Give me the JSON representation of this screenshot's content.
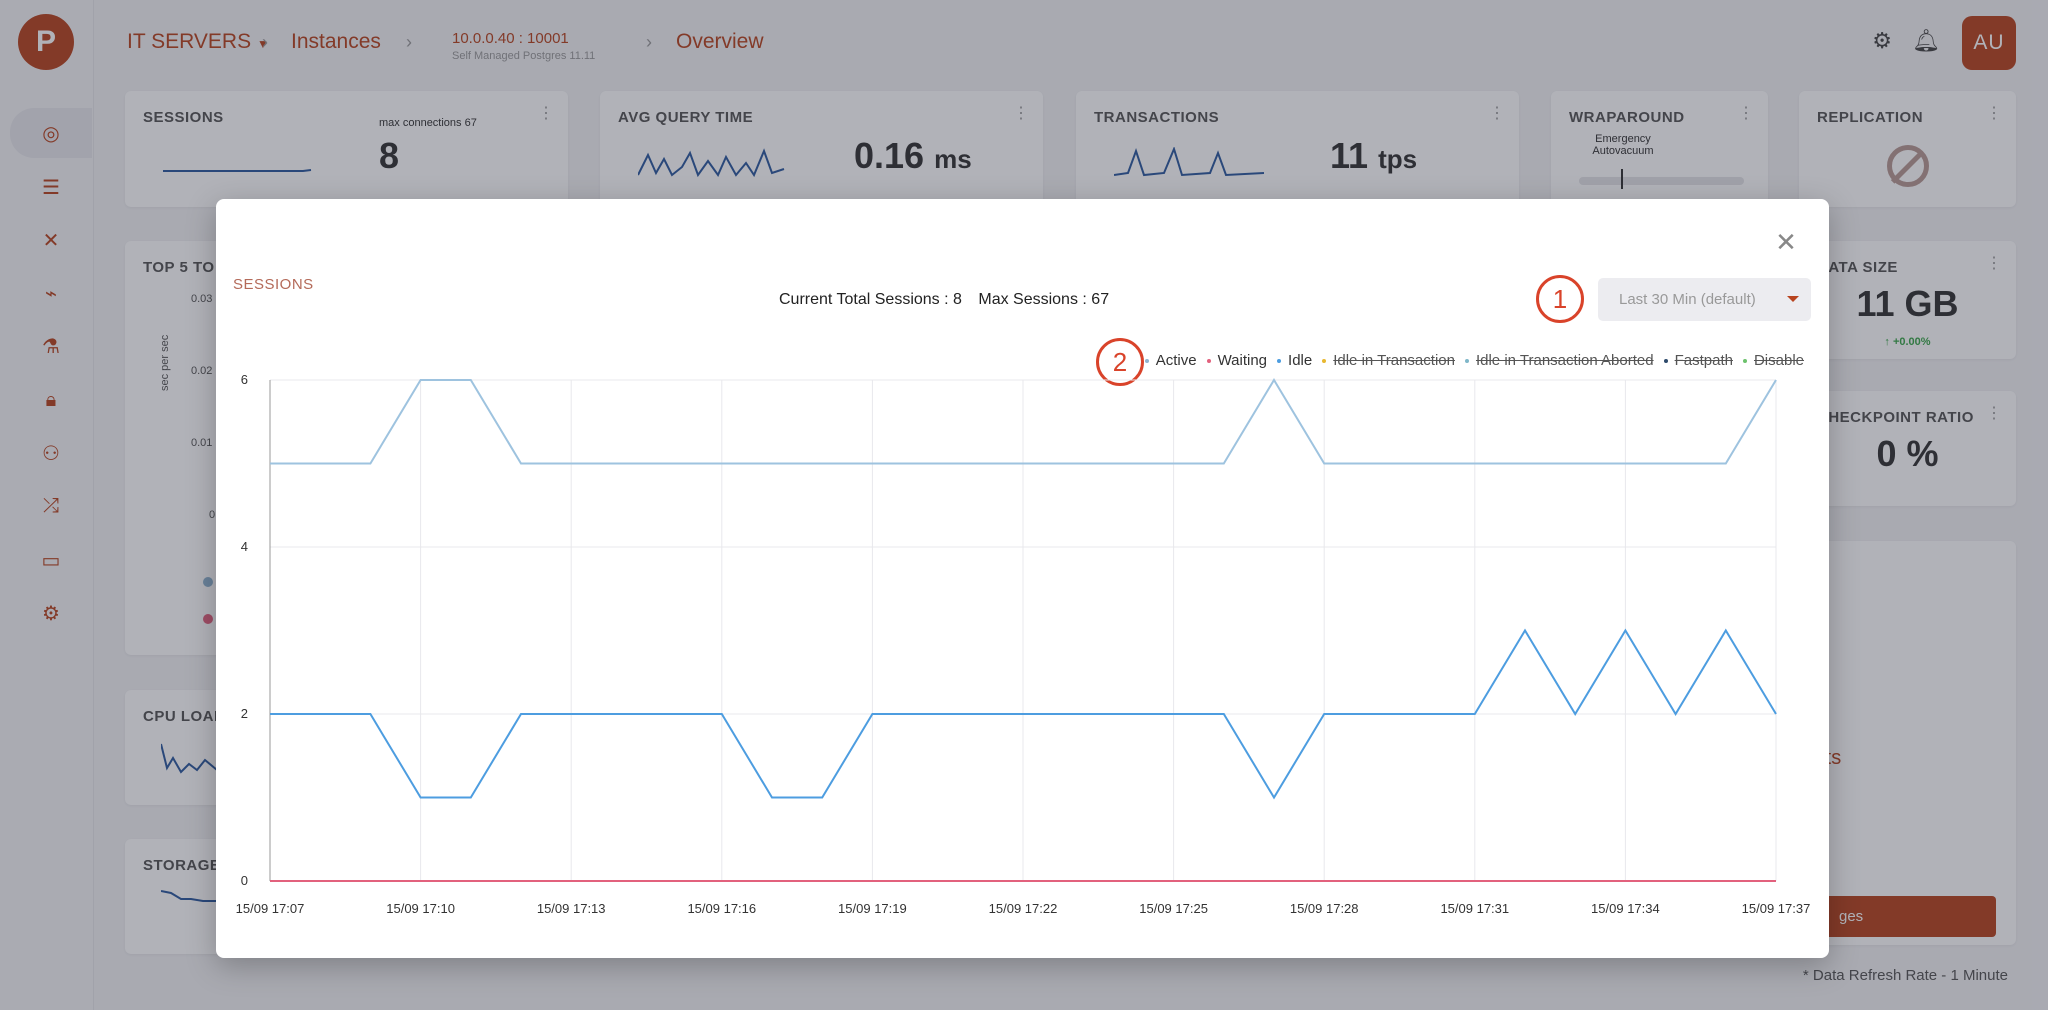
{
  "app": {
    "logo_glyph": "P",
    "nav_icons": [
      "dashboard-icon",
      "sliders-icon",
      "tools-icon",
      "telescope-icon",
      "microscope-icon",
      "lock-icon",
      "group-icon",
      "shuffle-icon",
      "folders-icon",
      "gear-icon"
    ]
  },
  "breadcrumb": {
    "group": "IT SERVERS",
    "section": "Instances",
    "instance": "10.0.0.40 : 10001",
    "instance_sub": "Self Managed Postgres 11.11",
    "page": "Overview"
  },
  "user": {
    "initials": "AU"
  },
  "cards": {
    "sessions": {
      "title": "SESSIONS",
      "caption": "max connections 67",
      "value": "8"
    },
    "query": {
      "title": "AVG QUERY TIME",
      "value": "0.16",
      "unit": "ms"
    },
    "transactions": {
      "title": "TRANSACTIONS",
      "value": "11",
      "unit": "tps"
    },
    "wraparound": {
      "title": "WRAPAROUND",
      "caption": "Emergency Autovacuum"
    },
    "replication": {
      "title": "REPLICATION"
    },
    "top5": {
      "title": "TOP 5 TO",
      "ylabel": "sec per sec",
      "ticks": [
        "0.03",
        "0.02",
        "0.01",
        "0"
      ]
    },
    "data_size": {
      "title": "DATA SIZE",
      "value": "11 GB",
      "delta": "↑ +0.00%"
    },
    "checkpoint": {
      "title": "CHECKPOINT RATIO",
      "value": "0 %"
    },
    "cpu": {
      "title": "CPU LOAD"
    },
    "storage": {
      "title": "STORAGE"
    },
    "reports_text": "rts",
    "action_button": "ges",
    "footnote": "* Data Refresh Rate - 1 Minute"
  },
  "modal": {
    "title": "SESSIONS",
    "current_total": "Current Total Sessions : 8",
    "max_sessions": "Max Sessions : 67",
    "range_label": "Last 30 Min (default)",
    "callouts": [
      "1",
      "2"
    ]
  },
  "chart_data": {
    "type": "line",
    "title": "SESSIONS",
    "x": [
      "15/09 17:07",
      "15/09 17:08",
      "15/09 17:09",
      "15/09 17:10",
      "15/09 17:11",
      "15/09 17:12",
      "15/09 17:13",
      "15/09 17:14",
      "15/09 17:15",
      "15/09 17:16",
      "15/09 17:17",
      "15/09 17:18",
      "15/09 17:19",
      "15/09 17:20",
      "15/09 17:21",
      "15/09 17:22",
      "15/09 17:23",
      "15/09 17:24",
      "15/09 17:25",
      "15/09 17:26",
      "15/09 17:27",
      "15/09 17:28",
      "15/09 17:29",
      "15/09 17:30",
      "15/09 17:31",
      "15/09 17:32",
      "15/09 17:33",
      "15/09 17:34",
      "15/09 17:35",
      "15/09 17:36",
      "15/09 17:37"
    ],
    "x_ticks": [
      "15/09 17:07",
      "15/09 17:10",
      "15/09 17:13",
      "15/09 17:16",
      "15/09 17:19",
      "15/09 17:22",
      "15/09 17:25",
      "15/09 17:28",
      "15/09 17:31",
      "15/09 17:34",
      "15/09 17:37"
    ],
    "ylim": [
      0,
      6
    ],
    "y_ticks": [
      0,
      2,
      4,
      6
    ],
    "grid": true,
    "legend_position": "top-right",
    "series": [
      {
        "name": "Active",
        "color": "#8fb3cf",
        "visible": true,
        "values": [
          0,
          0,
          0,
          0,
          0,
          0,
          0,
          0,
          0,
          0,
          0,
          0,
          0,
          0,
          0,
          0,
          0,
          0,
          0,
          0,
          0,
          0,
          0,
          0,
          0,
          0,
          0,
          0,
          0,
          0,
          0
        ]
      },
      {
        "name": "Waiting",
        "color": "#e2617d",
        "visible": true,
        "values": [
          0,
          0,
          0,
          0,
          0,
          0,
          0,
          0,
          0,
          0,
          0,
          0,
          0,
          0,
          0,
          0,
          0,
          0,
          0,
          0,
          0,
          0,
          0,
          0,
          0,
          0,
          0,
          0,
          0,
          0,
          0
        ]
      },
      {
        "name": "Idle",
        "color": "#4d9de0",
        "visible": true,
        "values": [
          2,
          2,
          2,
          1,
          1,
          2,
          2,
          2,
          2,
          2,
          1,
          1,
          2,
          2,
          2,
          2,
          2,
          2,
          2,
          2,
          1,
          2,
          2,
          2,
          2,
          3,
          2,
          3,
          2,
          3,
          2
        ]
      },
      {
        "name": "Idle in Transaction",
        "color": "#e8b830",
        "visible": false,
        "values": []
      },
      {
        "name": "Idle in Transaction Aborted",
        "color": "#7fb7c9",
        "visible": false,
        "values": []
      },
      {
        "name": "Fastpath",
        "color": "#2d4a6b",
        "visible": false,
        "values": []
      },
      {
        "name": "Disable",
        "color": "#6cc26c",
        "visible": false,
        "values": []
      },
      {
        "name": "",
        "color": "#9ec3df",
        "visible": true,
        "values": [
          5,
          5,
          5,
          6,
          6,
          5,
          5,
          5,
          5,
          5,
          5,
          5,
          5,
          5,
          5,
          5,
          5,
          5,
          5,
          5,
          6,
          5,
          5,
          5,
          5,
          5,
          5,
          5,
          5,
          5,
          6
        ]
      }
    ]
  }
}
